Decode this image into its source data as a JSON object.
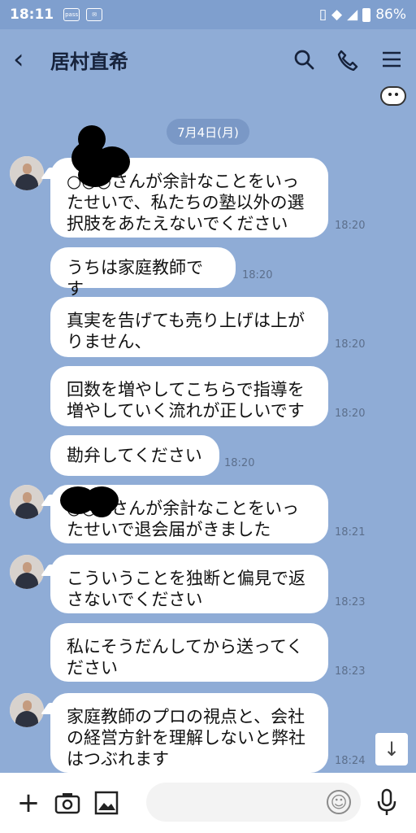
{
  "status": {
    "time": "18:11",
    "battery": "86%",
    "pass_label": "pass"
  },
  "header": {
    "title": "居村直希",
    "back": "〈",
    "search": "search-icon",
    "phone": "phone-icon",
    "menu": "menu-icon"
  },
  "date": "7月4日(月)",
  "messages": [
    {
      "text": "○○○さんが余計なことをいったせいで、私たちの塾以外の選択肢をあたえないでください",
      "time": "18:20"
    },
    {
      "text": "うちは家庭教師です",
      "time": "18:20"
    },
    {
      "text": "真実を告げても売り上げは上がりません、",
      "time": "18:20"
    },
    {
      "text": "回数を増やしてこちらで指導を増やしていく流れが正しいです",
      "time": "18:20"
    },
    {
      "text": "勘弁してください",
      "time": "18:20"
    },
    {
      "text": "○○○さんが余計なことをいったせいで退会届がきました",
      "time": "18:21"
    },
    {
      "text": "こういうことを独断と偏見で返さないでください",
      "time": "18:23"
    },
    {
      "text": "私にそうだんしてから送ってください",
      "time": "18:23"
    },
    {
      "text": "家庭教師のプロの視点と、会社の経営方針を理解しないと弊社はつぶれます",
      "time": "18:24"
    }
  ],
  "bottom": {
    "input_placeholder": "",
    "plus": "+",
    "emoji": "☺"
  },
  "scroll_down": "↓"
}
